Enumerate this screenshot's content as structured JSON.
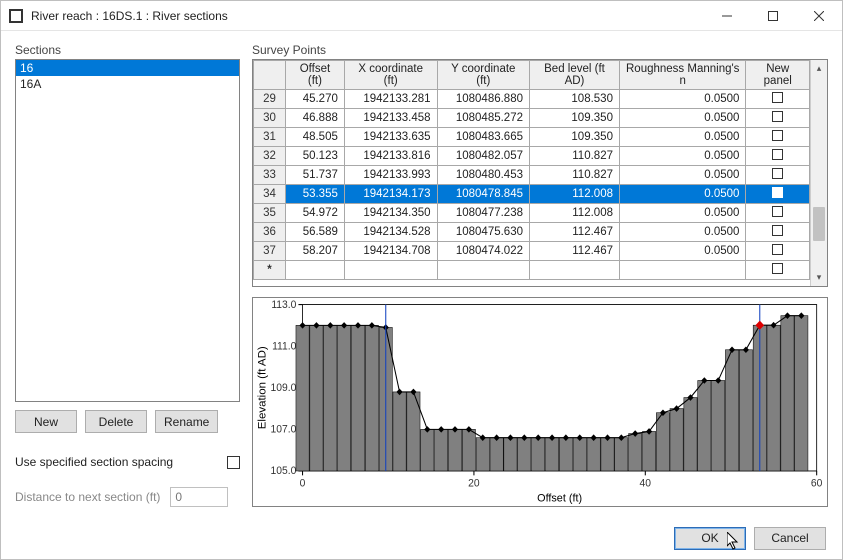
{
  "window": {
    "title": "River reach : 16DS.1 : River sections"
  },
  "sections": {
    "label": "Sections",
    "items": [
      {
        "name": "16",
        "selected": true
      },
      {
        "name": "16A",
        "selected": false
      }
    ],
    "buttons": {
      "new": "New",
      "delete": "Delete",
      "rename": "Rename"
    },
    "use_spacing_label": "Use specified section spacing",
    "use_spacing_checked": false,
    "distance_label": "Distance to next section (ft)",
    "distance_value": "0"
  },
  "survey": {
    "label": "Survey Points",
    "columns": [
      "",
      "Offset (ft)",
      "X coordinate (ft)",
      "Y coordinate (ft)",
      "Bed level (ft AD)",
      "Roughness Manning's n",
      "New panel"
    ],
    "rows": [
      {
        "n": "29",
        "offset": "45.270",
        "x": "1942133.281",
        "y": "1080486.880",
        "bed": "108.530",
        "rough": "0.0500",
        "panel": false,
        "selected": false
      },
      {
        "n": "30",
        "offset": "46.888",
        "x": "1942133.458",
        "y": "1080485.272",
        "bed": "109.350",
        "rough": "0.0500",
        "panel": false,
        "selected": false
      },
      {
        "n": "31",
        "offset": "48.505",
        "x": "1942133.635",
        "y": "1080483.665",
        "bed": "109.350",
        "rough": "0.0500",
        "panel": false,
        "selected": false
      },
      {
        "n": "32",
        "offset": "50.123",
        "x": "1942133.816",
        "y": "1080482.057",
        "bed": "110.827",
        "rough": "0.0500",
        "panel": false,
        "selected": false
      },
      {
        "n": "33",
        "offset": "51.737",
        "x": "1942133.993",
        "y": "1080480.453",
        "bed": "110.827",
        "rough": "0.0500",
        "panel": false,
        "selected": false
      },
      {
        "n": "34",
        "offset": "53.355",
        "x": "1942134.173",
        "y": "1080478.845",
        "bed": "112.008",
        "rough": "0.0500",
        "panel": true,
        "selected": true
      },
      {
        "n": "35",
        "offset": "54.972",
        "x": "1942134.350",
        "y": "1080477.238",
        "bed": "112.008",
        "rough": "0.0500",
        "panel": false,
        "selected": false
      },
      {
        "n": "36",
        "offset": "56.589",
        "x": "1942134.528",
        "y": "1080475.630",
        "bed": "112.467",
        "rough": "0.0500",
        "panel": false,
        "selected": false
      },
      {
        "n": "37",
        "offset": "58.207",
        "x": "1942134.708",
        "y": "1080474.022",
        "bed": "112.467",
        "rough": "0.0500",
        "panel": false,
        "selected": false
      },
      {
        "n": "*",
        "offset": "",
        "x": "",
        "y": "",
        "bed": "",
        "rough": "",
        "panel": false,
        "selected": false
      }
    ]
  },
  "chart_data": {
    "type": "bar",
    "title": "",
    "xlabel": "Offset (ft)",
    "ylabel": "Elevation (ft AD)",
    "xlim": [
      0,
      60
    ],
    "ylim": [
      105.0,
      113.0
    ],
    "xticks": [
      0,
      20,
      40,
      60
    ],
    "yticks": [
      105.0,
      107.0,
      109.0,
      111.0,
      113.0
    ],
    "x": [
      0.0,
      1.62,
      3.24,
      4.85,
      6.47,
      8.09,
      9.71,
      11.32,
      12.94,
      14.56,
      16.18,
      17.79,
      19.41,
      21.03,
      22.65,
      24.26,
      25.88,
      27.5,
      29.12,
      30.73,
      32.35,
      33.97,
      35.59,
      37.2,
      38.82,
      40.44,
      42.06,
      43.65,
      45.27,
      46.89,
      48.51,
      50.12,
      51.74,
      53.36,
      54.97,
      56.59,
      58.21
    ],
    "values": [
      112.0,
      112.0,
      112.0,
      112.0,
      112.0,
      112.0,
      111.9,
      108.8,
      108.8,
      107.0,
      107.0,
      107.0,
      107.0,
      106.6,
      106.6,
      106.6,
      106.6,
      106.6,
      106.6,
      106.6,
      106.6,
      106.6,
      106.6,
      106.6,
      106.8,
      106.9,
      107.8,
      108.0,
      108.53,
      109.35,
      109.35,
      110.827,
      110.827,
      112.008,
      112.008,
      112.467,
      112.467
    ],
    "panel_lines_x": [
      9.71,
      53.36
    ],
    "highlight_point": {
      "x": 53.36,
      "y": 112.008
    }
  },
  "footer": {
    "ok": "OK",
    "cancel": "Cancel"
  }
}
